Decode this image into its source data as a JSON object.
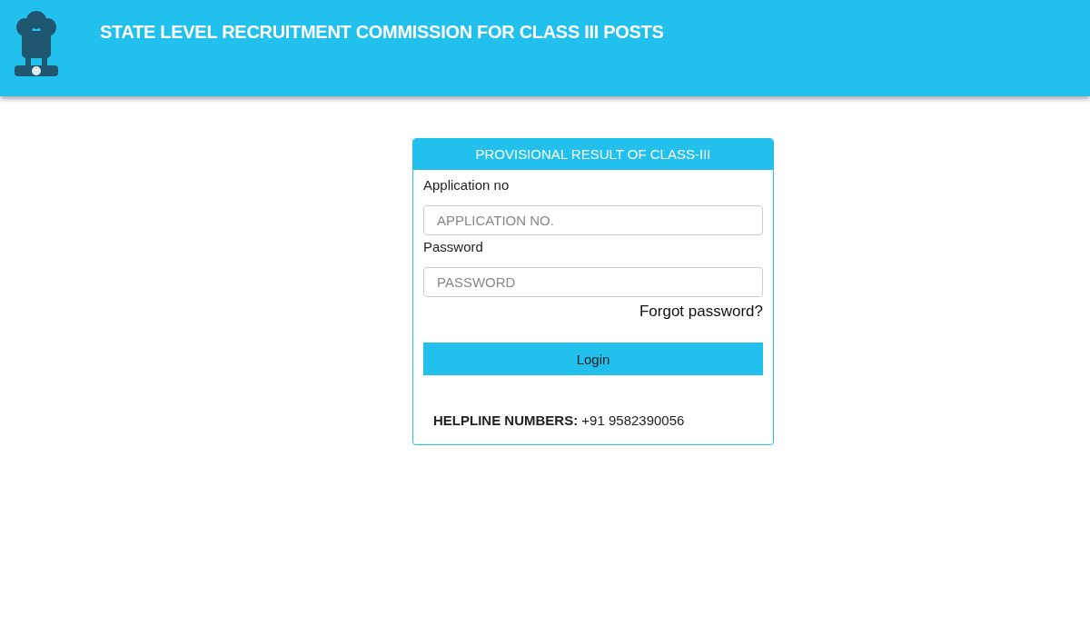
{
  "header": {
    "title": "STATE LEVEL RECRUITMENT COMMISSION FOR CLASS III POSTS"
  },
  "login_card": {
    "title": "PROVISIONAL RESULT OF CLASS-III",
    "fields": [
      {
        "label": "Application no",
        "placeholder": "APPLICATION NO."
      },
      {
        "label": "Password",
        "placeholder": "PASSWORD"
      }
    ],
    "forgot_link": "Forgot password?",
    "login_button": "Login",
    "helpline": "**HELPLINE NUMBERS:** +91 9582390056"
  }
}
